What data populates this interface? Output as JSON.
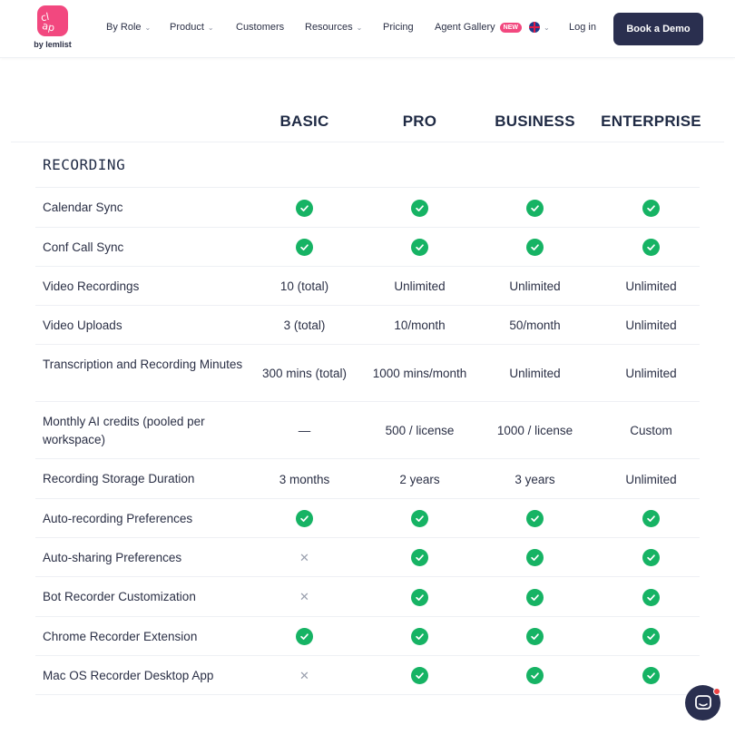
{
  "header": {
    "logo_text": "claap",
    "logo_sub": "by lemlist",
    "nav": [
      {
        "label": "By Role",
        "dropdown": true
      },
      {
        "label": "Product",
        "dropdown": true
      },
      {
        "label": "Customers",
        "dropdown": false
      },
      {
        "label": "Resources",
        "dropdown": true
      },
      {
        "label": "Pricing",
        "dropdown": false
      },
      {
        "label": "Agent Gallery",
        "dropdown": false
      }
    ],
    "new_badge": "NEW",
    "login": "Log in",
    "cta": "Book a Demo"
  },
  "plans": [
    "BASIC",
    "PRO",
    "BUSINESS",
    "ENTERPRISE"
  ],
  "section": "RECORDING",
  "rows": [
    {
      "label": "Calendar Sync",
      "values": [
        "check",
        "check",
        "check",
        "check"
      ]
    },
    {
      "label": "Conf Call Sync",
      "values": [
        "check",
        "check",
        "check",
        "check"
      ]
    },
    {
      "label": "Video Recordings",
      "values": [
        "10 (total)",
        "Unlimited",
        "Unlimited",
        "Unlimited"
      ]
    },
    {
      "label": "Video Uploads",
      "values": [
        "3 (total)",
        "10/month",
        "50/month",
        "Unlimited"
      ]
    },
    {
      "label": "Transcription and Recording Minutes",
      "values": [
        "300 mins (total)",
        "1000 mins/month",
        "Unlimited",
        "Unlimited"
      ]
    },
    {
      "label": "Monthly AI credits (pooled per workspace)",
      "values": [
        "—",
        "500 / license",
        "1000 / license",
        "Custom"
      ]
    },
    {
      "label": "Recording Storage Duration",
      "values": [
        "3 months",
        "2 years",
        "3 years",
        "Unlimited"
      ]
    },
    {
      "label": "Auto-recording Preferences",
      "values": [
        "check",
        "check",
        "check",
        "check"
      ]
    },
    {
      "label": "Auto-sharing Preferences",
      "values": [
        "cross",
        "check",
        "check",
        "check"
      ]
    },
    {
      "label": "Bot Recorder Customization",
      "values": [
        "cross",
        "check",
        "check",
        "check"
      ]
    },
    {
      "label": "Chrome Recorder Extension",
      "values": [
        "check",
        "check",
        "check",
        "check"
      ]
    },
    {
      "label": "Mac OS Recorder Desktop App",
      "values": [
        "cross",
        "check",
        "check",
        "check"
      ]
    }
  ],
  "icons": {
    "included": "check-circle-icon",
    "excluded": "cross-icon",
    "chat": "chat-bubble-icon",
    "language": "uk-flag-icon"
  },
  "colors": {
    "brand": "#f2487f",
    "check": "#16b364",
    "cta_bg": "#2a2f4f",
    "text": "#1f2a44"
  }
}
